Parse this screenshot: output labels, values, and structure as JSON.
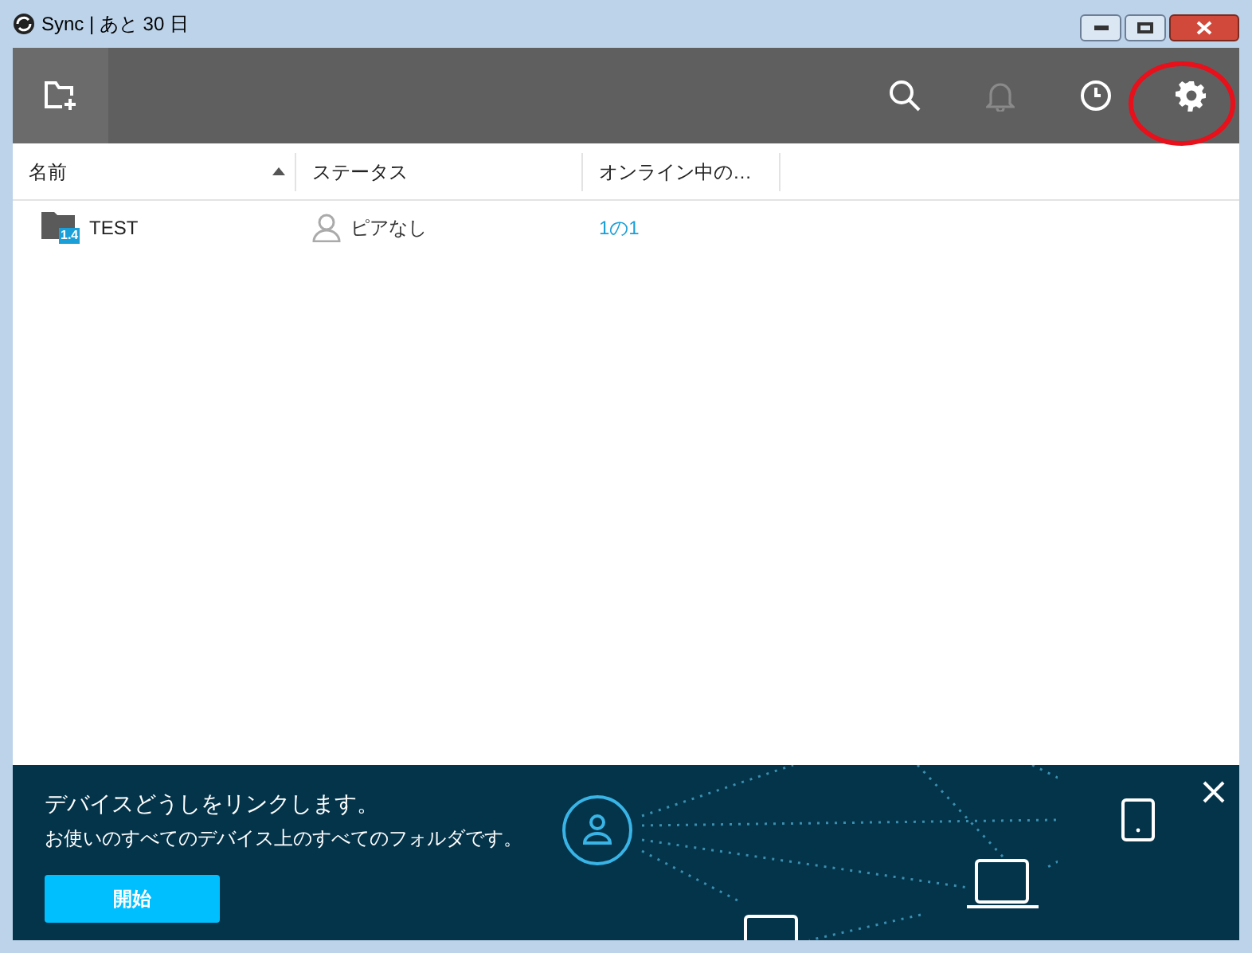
{
  "window": {
    "title": "Sync | あと 30 日"
  },
  "toolbar": {
    "notifications_disabled": true
  },
  "table": {
    "columns": [
      {
        "label": "名前",
        "sorted": true
      },
      {
        "label": "ステータス",
        "sorted": false
      },
      {
        "label": "オンライン中の…",
        "sorted": false
      }
    ],
    "rows": [
      {
        "name": "TEST",
        "badge": "1.4",
        "status": "ピアなし",
        "online": "1の1"
      }
    ]
  },
  "banner": {
    "title": "デバイスどうしをリンクします。",
    "text": "お使いのすべてのデバイス上のすべてのフォルダです。",
    "button": "開始"
  }
}
